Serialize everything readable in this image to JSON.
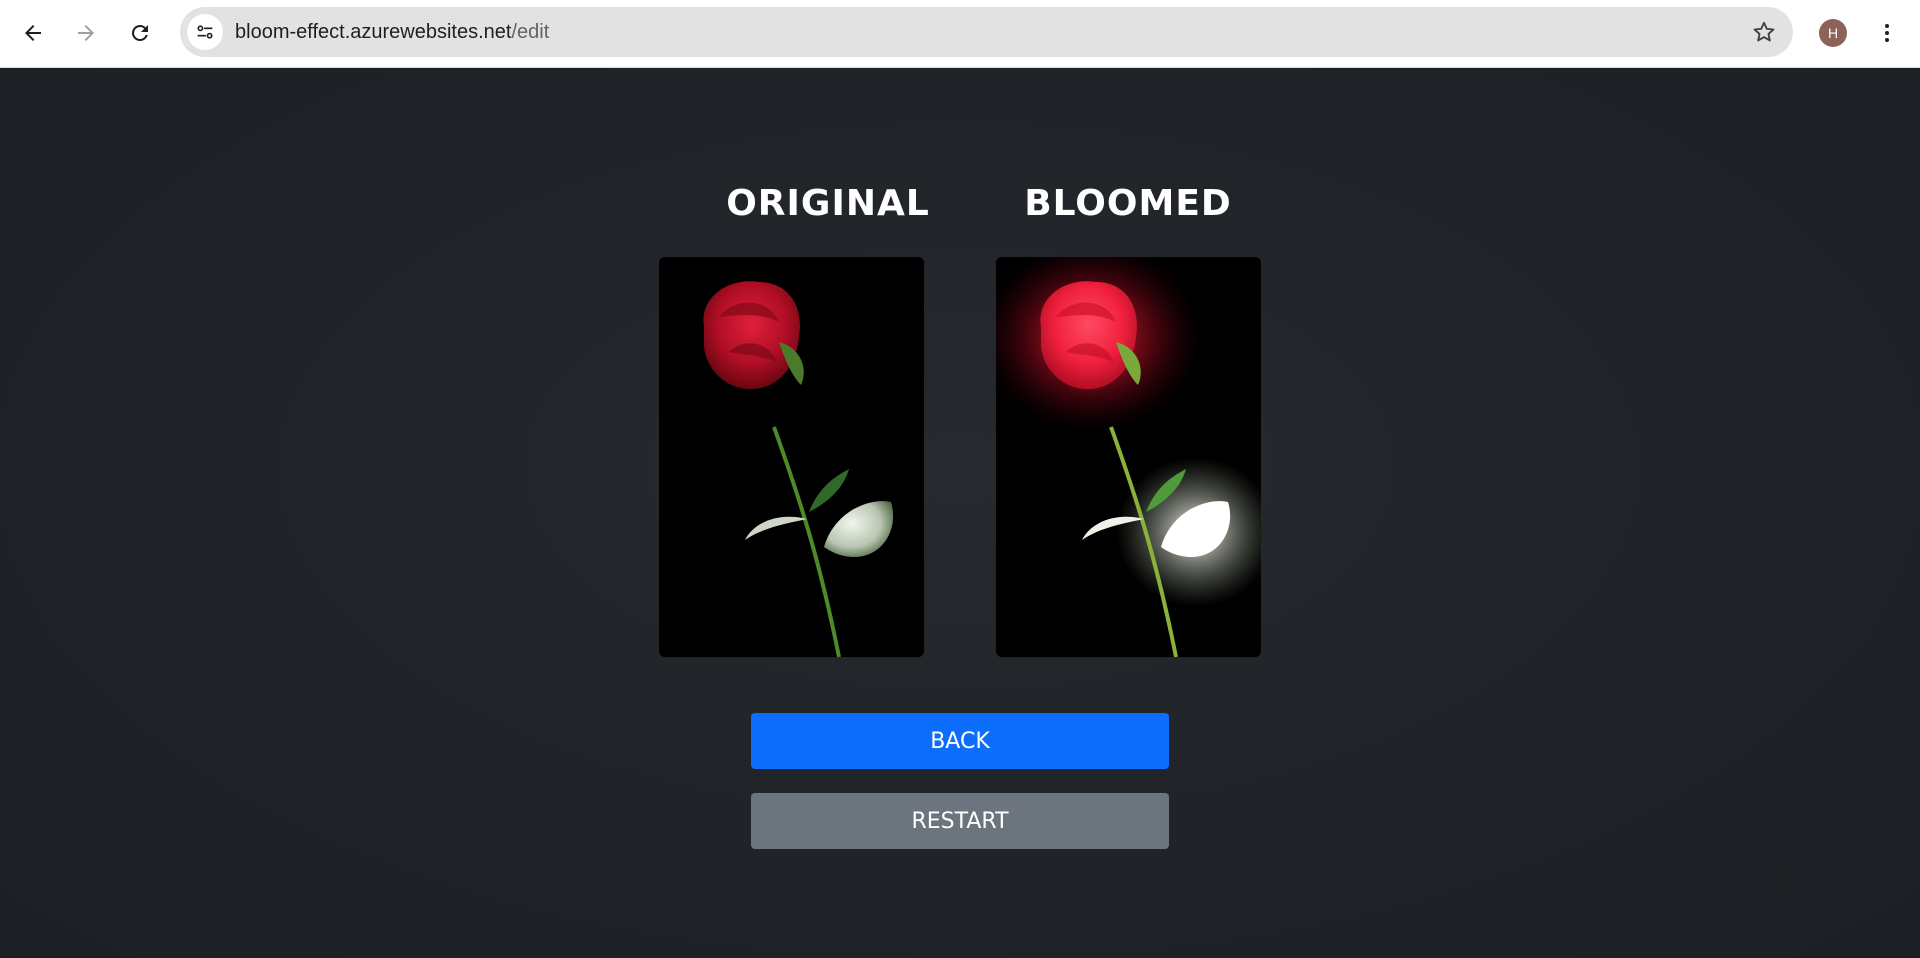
{
  "browser": {
    "url_host": "bloom-effect.azurewebsites.net",
    "url_path": "/edit",
    "profile_initial": "H",
    "icons": {
      "back": "arrow-left-icon",
      "forward": "arrow-right-icon",
      "reload": "reload-icon",
      "site_info": "tune-icon",
      "bookmark": "star-icon",
      "menu": "kebab-menu-icon"
    }
  },
  "main": {
    "original_title": "ORIGINAL",
    "bloomed_title": "BLOOMED",
    "back_label": "BACK",
    "restart_label": "RESTART"
  },
  "colors": {
    "page_background": "#202428",
    "back_button": "#0d6efd",
    "restart_button": "#6c757d",
    "rose": "#c8102e",
    "bloom_glow": "#ff2a4a"
  }
}
